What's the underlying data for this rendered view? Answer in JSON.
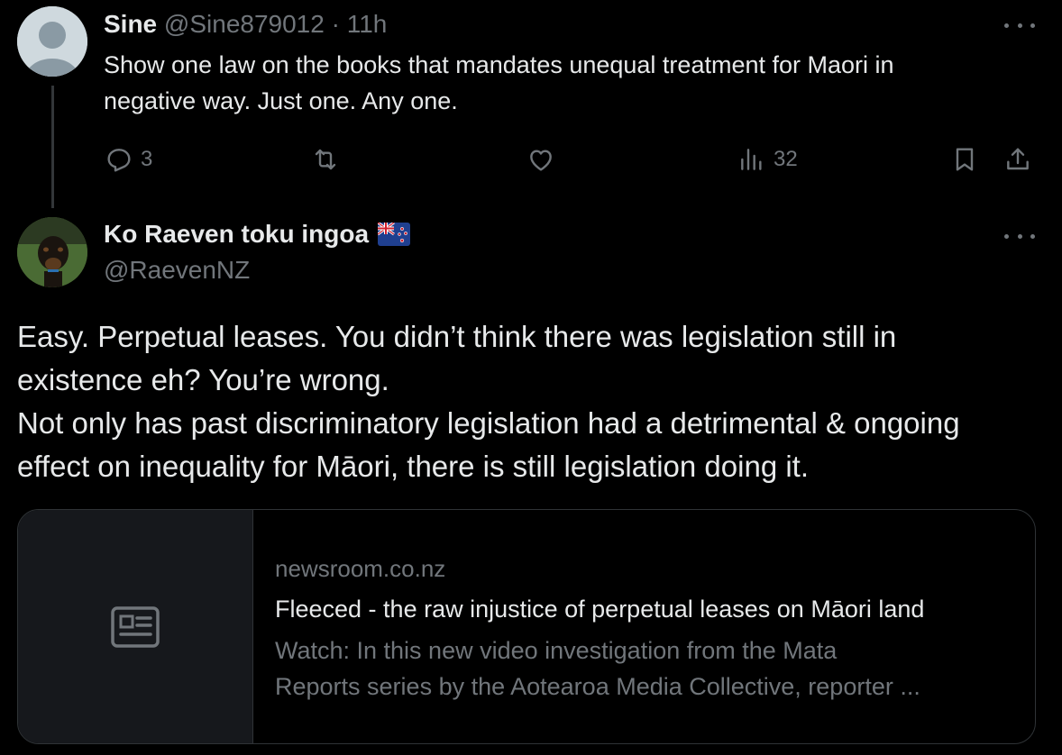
{
  "parent_tweet": {
    "display_name": "Sine",
    "handle": "@Sine879012",
    "separator": "·",
    "time": "11h",
    "text": "Show one law on the books that mandates unequal treatment for Maori in negative way. Just one. Any one.",
    "text_lines": [
      "Show one law on the books that mandates unequal treatment for Maori in",
      "negative way. Just one. Any one."
    ],
    "actions": {
      "reply_count": "3",
      "retweet_count": "",
      "like_count": "",
      "views_count": "32"
    }
  },
  "reply_tweet": {
    "display_name": "Ko Raeven toku ingoa",
    "flag_icon": "new-zealand-flag-icon",
    "handle": "@RaevenNZ",
    "text_lines": [
      "Easy. Perpetual leases. You didn’t think there was legislation still in",
      "existence eh?  You’re wrong.",
      "Not only has past discriminatory legislation had a detrimental & ongoing",
      "effect on inequality for Māori, there is still legislation doing it."
    ],
    "link_card": {
      "domain": "newsroom.co.nz",
      "title": "Fleeced - the raw injustice of perpetual leases on Māori land",
      "description_lines": [
        "Watch: In this new video investigation from the Mata",
        "Reports series by the Aotearoa Media Collective, reporter ..."
      ],
      "thumbnail_icon": "article-icon"
    }
  },
  "colors": {
    "background": "#000000",
    "text_primary": "#e7e9ea",
    "text_secondary": "#71767b",
    "border": "#2f3336",
    "card_thumb_bg": "#16181c"
  }
}
